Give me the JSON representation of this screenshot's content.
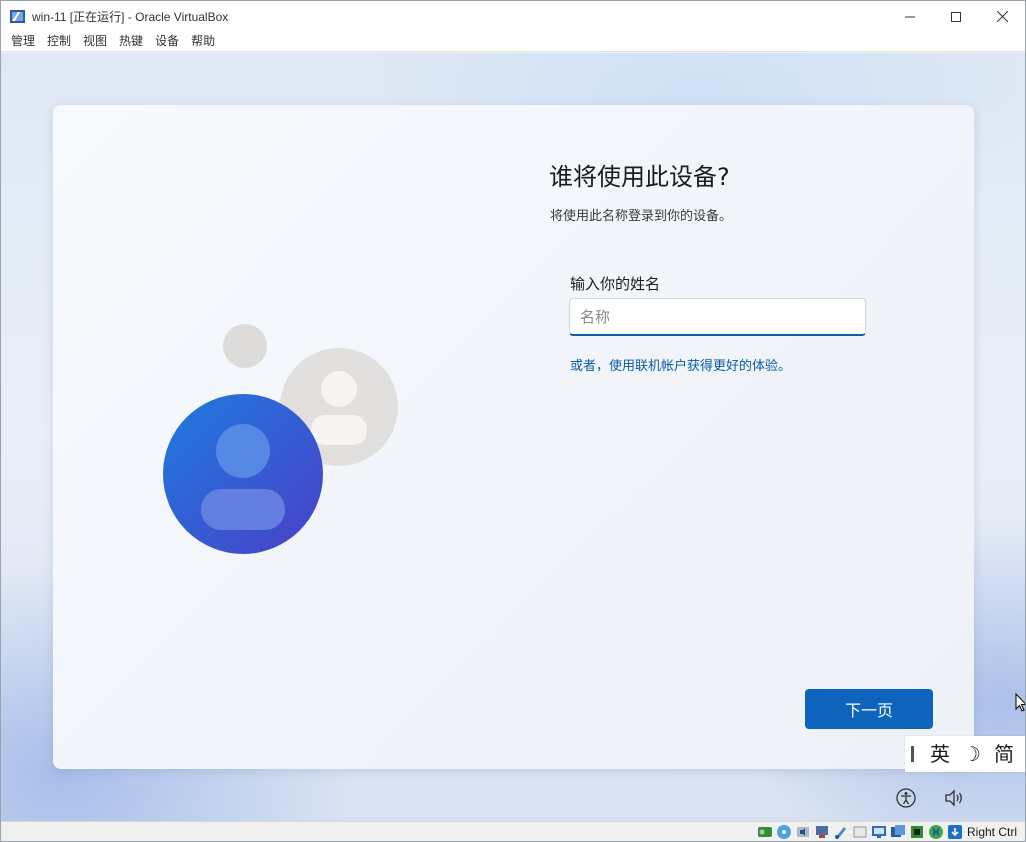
{
  "window": {
    "title": "win-11 [正在运行] - Oracle VirtualBox",
    "controls": [
      "minimize",
      "maximize",
      "close"
    ]
  },
  "menubar": {
    "items": [
      {
        "label": "管理"
      },
      {
        "label": "控制"
      },
      {
        "label": "视图"
      },
      {
        "label": "热键"
      },
      {
        "label": "设备"
      },
      {
        "label": "帮助"
      }
    ]
  },
  "oobe": {
    "title": "谁将使用此设备?",
    "subtitle": "将使用此名称登录到你的设备。",
    "field_label": "输入你的姓名",
    "input": {
      "value": "",
      "placeholder": "名称"
    },
    "alt_link": "或者，使用联机帐户获得更好的体验。",
    "next_button": "下一页"
  },
  "ime": {
    "items": [
      {
        "label": "英"
      },
      {
        "label": "☽"
      },
      {
        "label": "简"
      }
    ]
  },
  "tray_icons": [
    "accessibility-icon",
    "volume-icon"
  ],
  "statusbar": {
    "icons": [
      "hard-disk-icon",
      "optical-drive-icon",
      "audio-icon",
      "network-icon",
      "usb-icon",
      "shared-folders-icon",
      "display-icon",
      "recording-icon",
      "processor-icon",
      "mouse-integration-icon",
      "keyboard-icon"
    ],
    "host_key": "Right Ctrl"
  },
  "colors": {
    "accent": "#0e64bd",
    "link": "#0a5aa8",
    "avatar_blue": "#1f5fd0",
    "avatar_gray": "#dcdcdc"
  }
}
